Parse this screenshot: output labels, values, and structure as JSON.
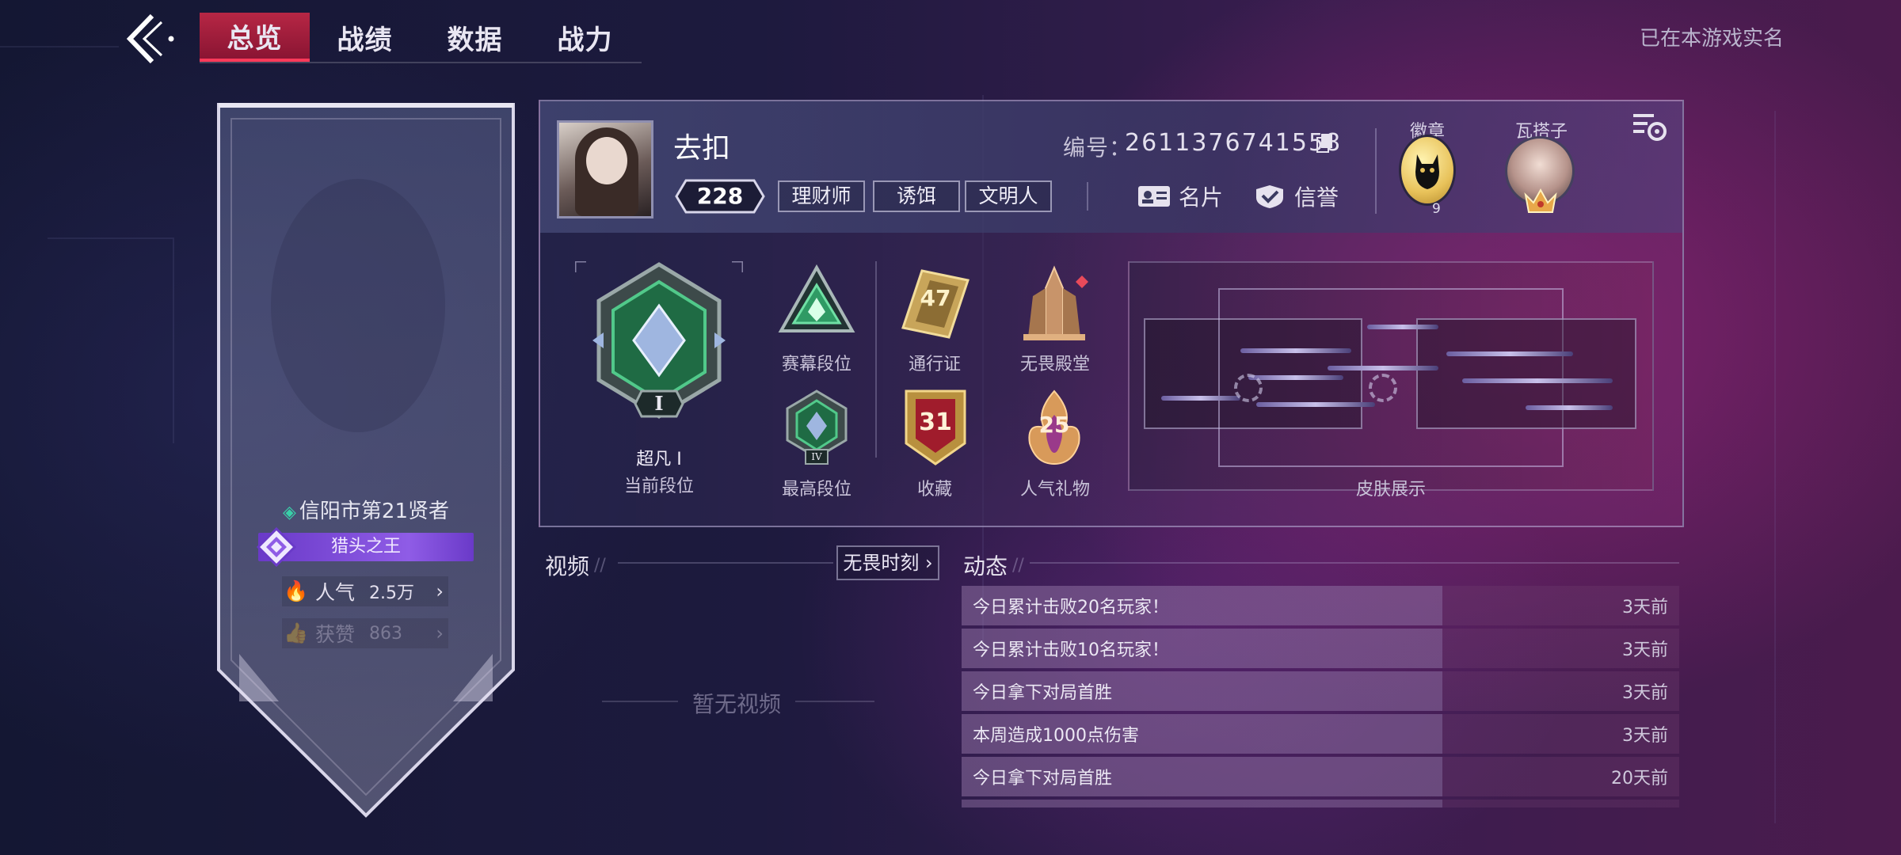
{
  "tabs": [
    "总览",
    "战绩",
    "数据",
    "战力"
  ],
  "realname_status": "已在本游戏实名",
  "profile": {
    "city_title": "信阳市第21贤者",
    "hunter_badge": "猎头之王",
    "popularity_label": "人气",
    "popularity_value": "2.5万",
    "likes_label": "获赞",
    "likes_value": "863"
  },
  "player": {
    "name": "去扣",
    "level": "228",
    "titles": [
      "理财师",
      "诱饵",
      "文明人"
    ],
    "id_label": "编号：",
    "id_value": "2611376741558",
    "card_button": "名片",
    "credit_button": "信誉",
    "medal_label": "徽章",
    "medal_count": "9",
    "friend_label": "瓦搭子"
  },
  "ranks": {
    "current_rank_name": "超凡 I",
    "current_rank_label": "当前段位",
    "rank_numeral": "I",
    "season_rank_label": "赛幕段位",
    "highest_rank_label": "最高段位",
    "highest_rank_numeral": "IV",
    "battlepass_label": "通行证",
    "battlepass_value": "47",
    "hall_label": "无畏殿堂",
    "collection_label": "收藏",
    "collection_value": "31",
    "gift_label": "人气礼物",
    "gift_value": "25",
    "skin_label": "皮肤展示"
  },
  "video": {
    "title": "视频",
    "button": "无畏时刻",
    "empty": "暂无视频"
  },
  "feed": {
    "title": "动态",
    "items": [
      {
        "text": "今日累计击败20名玩家！",
        "time": "3天前"
      },
      {
        "text": "今日累计击败10名玩家！",
        "time": "3天前"
      },
      {
        "text": "今日拿下对局首胜",
        "time": "3天前"
      },
      {
        "text": "本周造成1000点伤害",
        "time": "3天前"
      },
      {
        "text": "今日拿下对局首胜",
        "time": "20天前"
      }
    ]
  },
  "colors": {
    "accent_red": "#ff3a5a",
    "rank_green": "#2fae6a",
    "badge_purple": "#7b4ad8",
    "gold": "#e8c25a"
  }
}
